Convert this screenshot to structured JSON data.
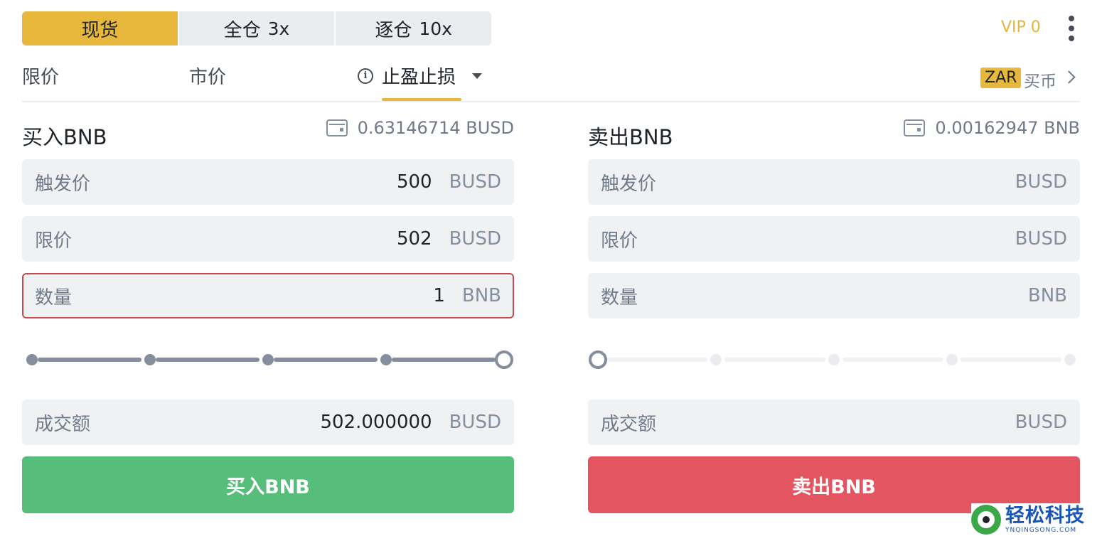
{
  "mode_tabs": [
    {
      "label": "现货",
      "leverage": ""
    },
    {
      "label": "全仓",
      "leverage": "3x"
    },
    {
      "label": "逐仓",
      "leverage": "10x"
    }
  ],
  "vip_level": "VIP 0",
  "order_types": {
    "limit": "限价",
    "market": "市价",
    "stop_limit": "止盈止损"
  },
  "fiat": {
    "currency": "ZAR",
    "buy_label": "买币"
  },
  "buy": {
    "title": "买入BNB",
    "balance": "0.63146714 BUSD",
    "fields": [
      {
        "label": "触发价",
        "value": "500",
        "unit": "BUSD"
      },
      {
        "label": "限价",
        "value": "502",
        "unit": "BUSD"
      },
      {
        "label": "数量",
        "value": "1",
        "unit": "BNB"
      }
    ],
    "slider_percent": 100,
    "total": {
      "label": "成交额",
      "value": "502.000000",
      "unit": "BUSD"
    },
    "button": "买入BNB"
  },
  "sell": {
    "title": "卖出BNB",
    "balance": "0.00162947 BNB",
    "fields": [
      {
        "label": "触发价",
        "value": "",
        "unit": "BUSD"
      },
      {
        "label": "限价",
        "value": "",
        "unit": "BUSD"
      },
      {
        "label": "数量",
        "value": "",
        "unit": "BNB"
      }
    ],
    "slider_percent": 0,
    "total": {
      "label": "成交额",
      "value": "",
      "unit": "BUSD"
    },
    "button": "卖出BNB"
  },
  "watermark": {
    "title": "轻松科技",
    "subtitle": "YNQINGSONG.COM"
  },
  "colors": {
    "accent": "#e8b83c",
    "buy": "#56bd7b",
    "sell": "#e35561",
    "focus_border": "#c8484f"
  }
}
